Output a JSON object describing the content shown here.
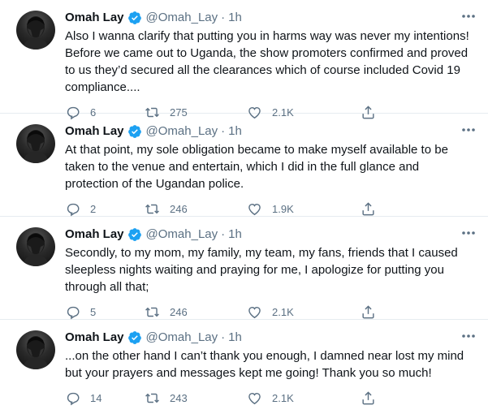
{
  "tweets": [
    {
      "name": "Omah Lay",
      "handle": "@Omah_Lay",
      "separator": "·",
      "time": "1h",
      "text": "Also I wanna clarify that putting you in harms way was never my intentions! Before we came out to Uganda, the show promoters confirmed and proved to us they’d secured all the clearances which of course included Covid 19 compliance....",
      "replies": "6",
      "retweets": "275",
      "likes": "2.1K"
    },
    {
      "name": "Omah Lay",
      "handle": "@Omah_Lay",
      "separator": "·",
      "time": "1h",
      "text": "At that point, my sole obligation became to make myself available to be taken to the venue and entertain, which I did in the full glance and protection of the Ugandan police.",
      "replies": "2",
      "retweets": "246",
      "likes": "1.9K"
    },
    {
      "name": "Omah Lay",
      "handle": "@Omah_Lay",
      "separator": "·",
      "time": "1h",
      "text": "Secondly, to my mom, my family, my team, my fans, friends that I caused sleepless nights waiting and praying for me, I apologize for putting you through all that;",
      "replies": "5",
      "retweets": "246",
      "likes": "2.1K"
    },
    {
      "name": "Omah Lay",
      "handle": "@Omah_Lay",
      "separator": "·",
      "time": "1h",
      "text": "...on the other hand I can’t thank you enough, I damned near lost my mind but your prayers and messages kept me going! Thank you so much!",
      "replies": "14",
      "retweets": "243",
      "likes": "2.1K"
    }
  ],
  "icons": {
    "verified": "verified-badge-icon",
    "more": "more-dots-icon",
    "reply": "reply-icon",
    "retweet": "retweet-icon",
    "like": "heart-icon",
    "share": "share-icon"
  },
  "colors": {
    "text": "#0f1419",
    "secondary": "#5b7083",
    "verified": "#1da1f2",
    "divider": "#e6ecf0"
  }
}
